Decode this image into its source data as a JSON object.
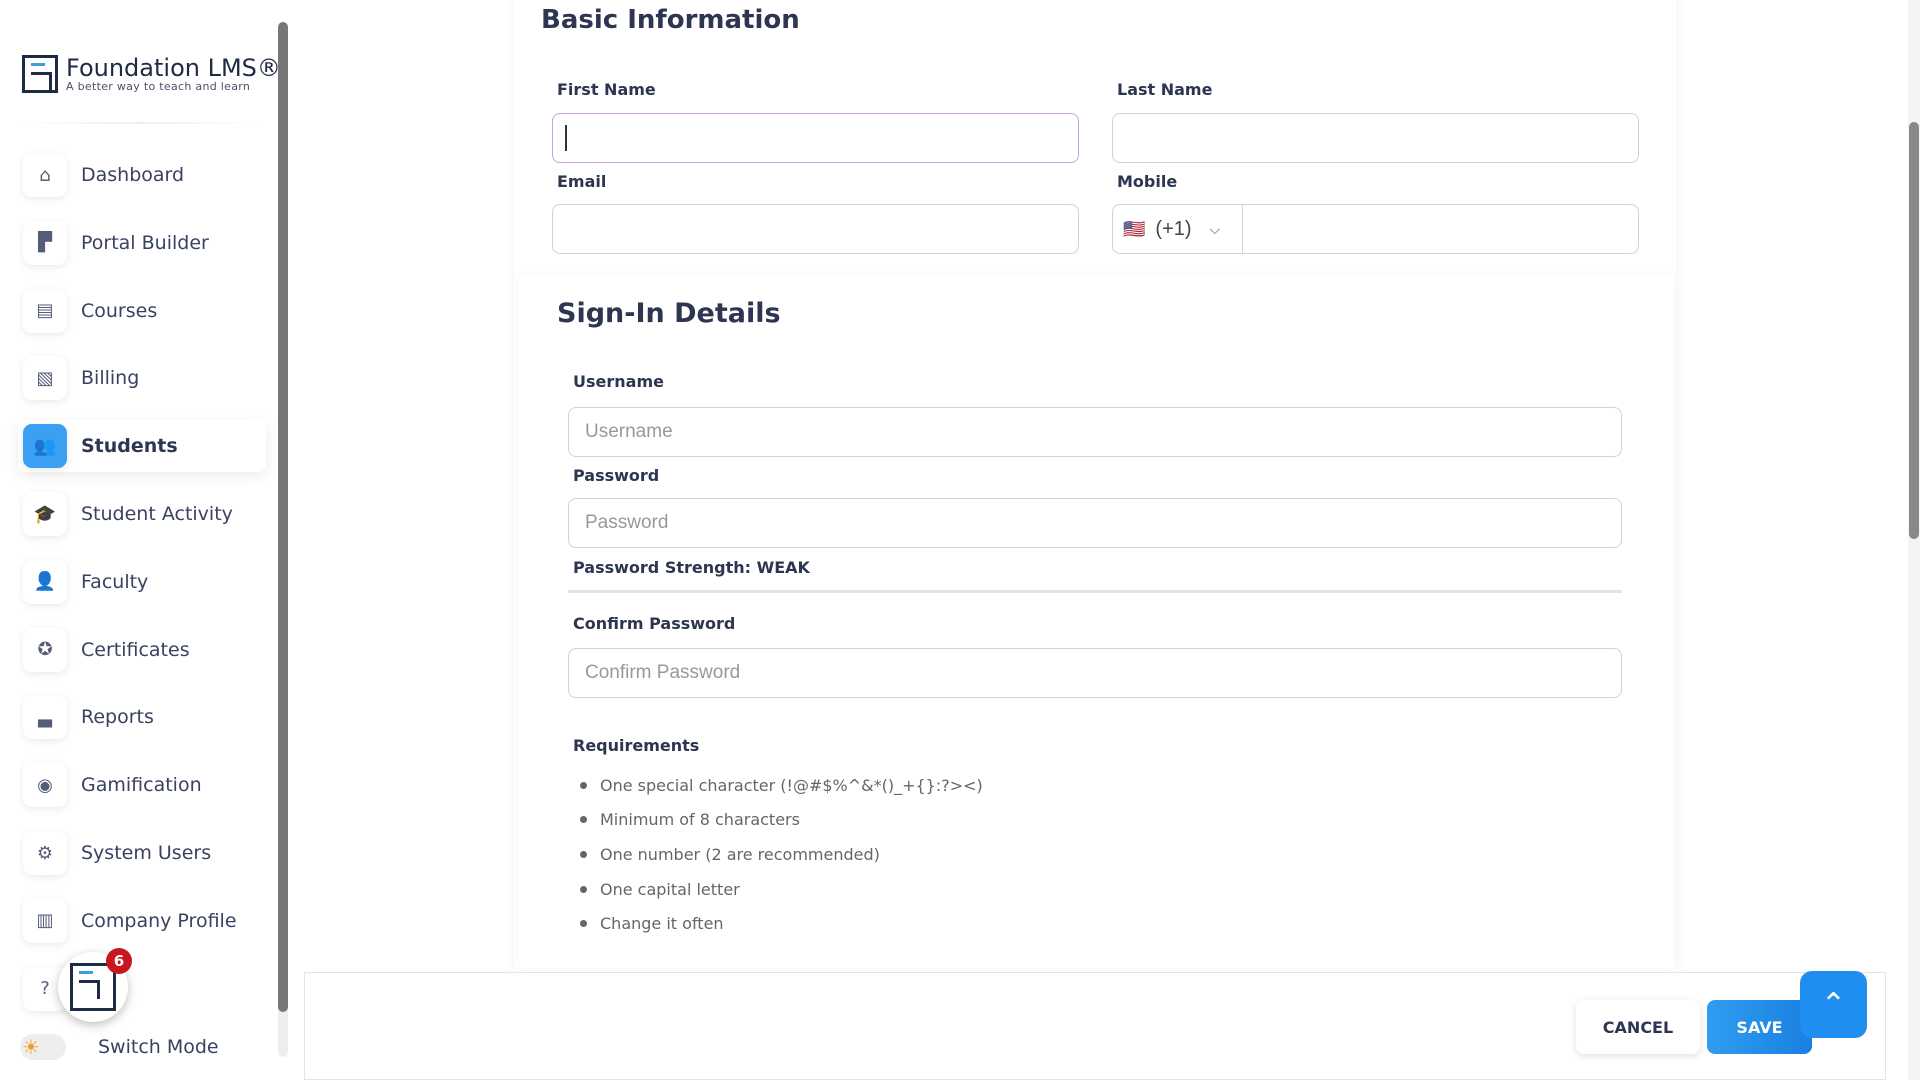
{
  "brand": {
    "name": "Foundation LMS®",
    "tagline": "A better way to teach and learn"
  },
  "sidebar": {
    "items": [
      {
        "label": "Dashboard",
        "icon": "home-icon",
        "glyph": "⌂"
      },
      {
        "label": "Portal Builder",
        "icon": "portal-icon",
        "glyph": "▛"
      },
      {
        "label": "Courses",
        "icon": "book-icon",
        "glyph": "▤"
      },
      {
        "label": "Billing",
        "icon": "invoice-icon",
        "glyph": "▧"
      },
      {
        "label": "Students",
        "icon": "students-icon",
        "glyph": "👥",
        "active": true
      },
      {
        "label": "Student Activity",
        "icon": "graduation-cap-icon",
        "glyph": "🎓"
      },
      {
        "label": "Faculty",
        "icon": "faculty-icon",
        "glyph": "👤"
      },
      {
        "label": "Certificates",
        "icon": "award-icon",
        "glyph": "✪"
      },
      {
        "label": "Reports",
        "icon": "chart-icon",
        "glyph": "▃"
      },
      {
        "label": "Gamification",
        "icon": "gamepad-icon",
        "glyph": "◉"
      },
      {
        "label": "System Users",
        "icon": "users-gear-icon",
        "glyph": "⚙"
      },
      {
        "label": "Company Profile",
        "icon": "building-icon",
        "glyph": "▥"
      },
      {
        "label": "Help",
        "icon": "question-icon",
        "glyph": "?"
      }
    ],
    "switch_mode": "Switch Mode",
    "notification_count": "6"
  },
  "basic": {
    "title": "Basic Information",
    "first_name": "First Name",
    "last_name": "Last Name",
    "email": "Email",
    "mobile": "Mobile",
    "country_code": "(+1)",
    "flag": "🇺🇸"
  },
  "signin": {
    "title": "Sign-In Details",
    "username_label": "Username",
    "username_placeholder": "Username",
    "password_label": "Password",
    "password_placeholder": "Password",
    "strength": "Password Strength: WEAK",
    "confirm_label": "Confirm Password",
    "confirm_placeholder": "Confirm Password",
    "requirements_title": "Requirements",
    "requirements": [
      "One special character (!@#$%^&*()_+{}:?><)",
      "Minimum of 8 characters",
      "One number (2 are recommended)",
      "One capital letter",
      "Change it often"
    ]
  },
  "footer": {
    "cancel": "CANCEL",
    "save": "SAVE"
  },
  "colors": {
    "accent": "#1f8ef1",
    "badge": "#c8161d"
  }
}
